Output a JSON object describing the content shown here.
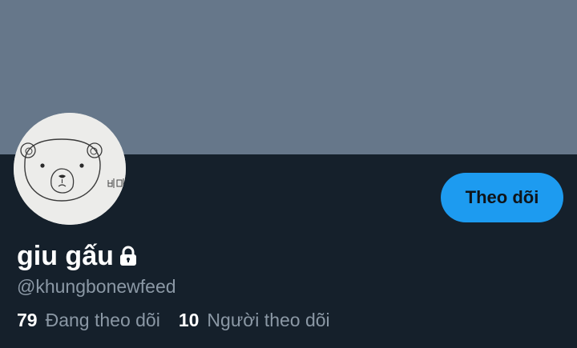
{
  "profile": {
    "display_name": "giu gấu",
    "handle": "@khungbonewfeed",
    "protected_icon": "lock-icon",
    "avatar": {
      "icon": "bear-face-drawing",
      "signature_text": "병미"
    }
  },
  "actions": {
    "follow_label": "Theo dõi"
  },
  "stats": {
    "following": {
      "count": "79",
      "label": "Đang theo dõi"
    },
    "followers": {
      "count": "10",
      "label": "Người theo dõi"
    }
  },
  "colors": {
    "banner": "#66778a",
    "background": "#15202b",
    "accent": "#1d9bf0",
    "secondary_text": "#8b98a5"
  }
}
